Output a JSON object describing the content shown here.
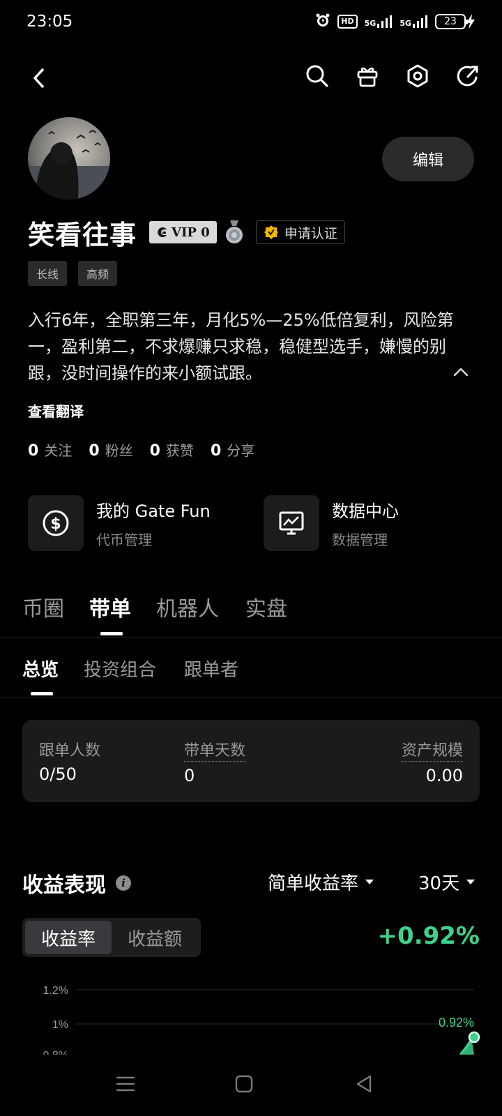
{
  "status_bar": {
    "time": "23:05",
    "hd": "HD",
    "net1": "5G",
    "net2": "5G",
    "battery": "23"
  },
  "profile": {
    "name": "笑看往事",
    "vip": "VIP 0",
    "verify": "申请认证",
    "edit": "编辑",
    "tags": [
      "长线",
      "高频"
    ],
    "bio": "入行6年，全职第三年，月化5%—25%低倍复利，风险第一，盈利第二，不求爆赚只求稳，稳健型选手，嫌慢的别跟，没时间操作的来小额试跟。",
    "translate": "查看翻译",
    "stats": [
      {
        "num": "0",
        "label": "关注"
      },
      {
        "num": "0",
        "label": "粉丝"
      },
      {
        "num": "0",
        "label": "获赞"
      },
      {
        "num": "0",
        "label": "分享"
      }
    ]
  },
  "features": [
    {
      "title": "我的 Gate Fun",
      "subtitle": "代币管理",
      "icon": "dollar-circle-icon"
    },
    {
      "title": "数据中心",
      "subtitle": "数据管理",
      "icon": "chart-monitor-icon"
    }
  ],
  "main_tabs": [
    "币圈",
    "带单",
    "机器人",
    "实盘"
  ],
  "sub_tabs": [
    "总览",
    "投资组合",
    "跟单者"
  ],
  "summary": {
    "followers_label": "跟单人数",
    "followers_value": "0/50",
    "days_label": "带单天数",
    "days_value": "0",
    "assets_label": "资产规模",
    "assets_value": "0.00"
  },
  "performance": {
    "title": "收益表现",
    "metric_dropdown": "简单收益率",
    "period_dropdown": "30天",
    "seg_rate": "收益率",
    "seg_amount": "收益额",
    "gain": "+0.92%"
  },
  "chart_data": {
    "type": "line",
    "y_ticks": [
      "1.2%",
      "1%"
    ],
    "last_point_label": "0.92%",
    "series": [
      {
        "values": [
          0.92
        ]
      }
    ],
    "line_color": "#3fd08b"
  }
}
